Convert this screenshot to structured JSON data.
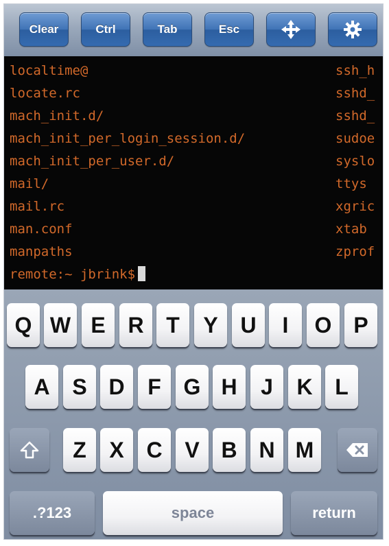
{
  "toolbar": {
    "buttons": [
      {
        "label": "Clear"
      },
      {
        "label": "Ctrl"
      },
      {
        "label": "Tab"
      },
      {
        "label": "Esc"
      },
      {
        "icon": "move-arrows-icon"
      },
      {
        "icon": "gear-icon"
      }
    ]
  },
  "terminal": {
    "left_lines": [
      "localtime@",
      "locate.rc",
      "mach_init.d/",
      "mach_init_per_login_session.d/",
      "mach_init_per_user.d/",
      "mail/",
      "mail.rc",
      "man.conf",
      "manpaths"
    ],
    "right_lines": [
      "ssh_h",
      "sshd_",
      "sshd_",
      "sudoe",
      "syslo",
      "ttys",
      "xgric",
      "xtab",
      "zprof"
    ],
    "prompt": "remote:~ jbrink$",
    "text_color": "#d2692a",
    "background": "#060606"
  },
  "keyboard": {
    "row1": [
      "Q",
      "W",
      "E",
      "R",
      "T",
      "Y",
      "U",
      "I",
      "O",
      "P"
    ],
    "row2": [
      "A",
      "S",
      "D",
      "F",
      "G",
      "H",
      "J",
      "K",
      "L"
    ],
    "row3": [
      "Z",
      "X",
      "C",
      "V",
      "B",
      "N",
      "M"
    ],
    "shift_icon": "shift-arrow-icon",
    "backspace_icon": "backspace-icon",
    "numbers_label": ".?123",
    "space_label": "space",
    "return_label": "return"
  }
}
